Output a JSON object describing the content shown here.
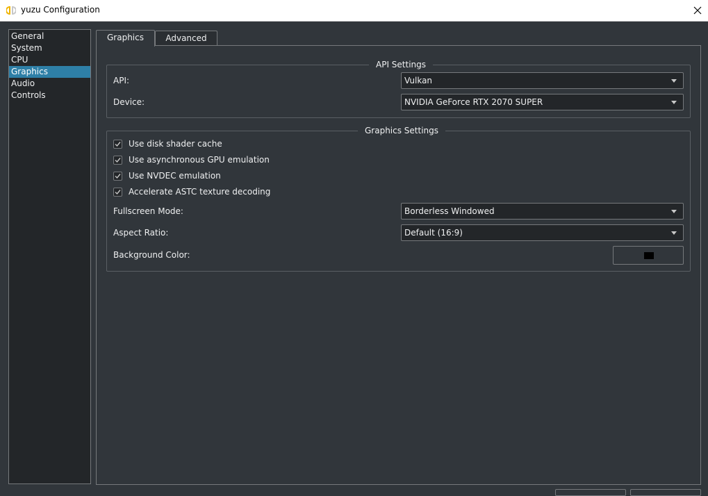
{
  "window": {
    "title": "yuzu Configuration",
    "icon": "yuzu-logo-icon",
    "close_icon": "close-icon"
  },
  "sidebar": {
    "items": [
      {
        "label": "General"
      },
      {
        "label": "System"
      },
      {
        "label": "CPU"
      },
      {
        "label": "Graphics",
        "selected": true
      },
      {
        "label": "Audio"
      },
      {
        "label": "Controls"
      }
    ]
  },
  "tabs": [
    {
      "label": "Graphics",
      "active": true
    },
    {
      "label": "Advanced",
      "active": false
    }
  ],
  "api_settings": {
    "title": "API Settings",
    "api": {
      "label": "API:",
      "value": "Vulkan"
    },
    "device": {
      "label": "Device:",
      "value": "NVIDIA GeForce RTX 2070 SUPER"
    }
  },
  "graphics_settings": {
    "title": "Graphics Settings",
    "checkboxes": [
      {
        "label": "Use disk shader cache",
        "checked": true
      },
      {
        "label": "Use asynchronous GPU emulation",
        "checked": true
      },
      {
        "label": "Use NVDEC emulation",
        "checked": true
      },
      {
        "label": "Accelerate ASTC texture decoding",
        "checked": true
      }
    ],
    "fullscreen_mode": {
      "label": "Fullscreen Mode:",
      "value": "Borderless Windowed"
    },
    "aspect_ratio": {
      "label": "Aspect Ratio:",
      "value": "Default (16:9)"
    },
    "background_color": {
      "label": "Background Color:",
      "color": "#000000"
    }
  },
  "colors": {
    "accent": "#2e7fa7",
    "background": "#31363b",
    "border": "#76797c"
  }
}
